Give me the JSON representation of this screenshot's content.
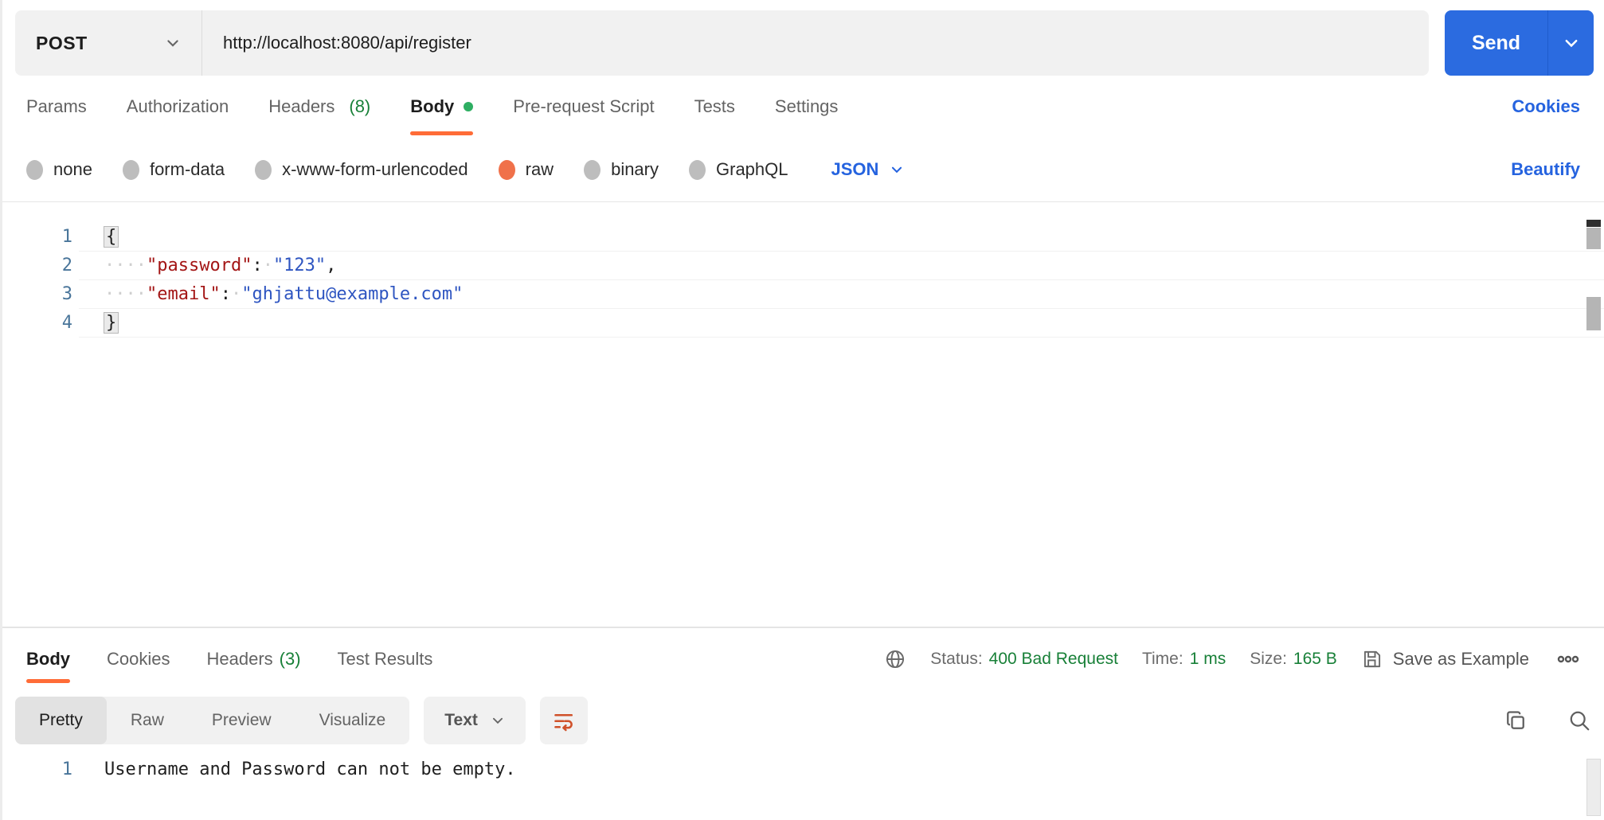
{
  "accents": {
    "orange": "#ff6c37",
    "blue": "#2563df",
    "send_blue": "#2b6be0",
    "green": "#188038",
    "unsaved_dot_green": "#2eae62",
    "key_red": "#a31515",
    "value_blue": "#2e55c1",
    "line_number_blue": "#49759a"
  },
  "request": {
    "method": "POST",
    "url": "http://localhost:8080/api/register",
    "send_label": "Send",
    "cookies_link": "Cookies",
    "beautify_link": "Beautify",
    "tabs": [
      {
        "label": "Params"
      },
      {
        "label": "Authorization"
      },
      {
        "label": "Headers",
        "count": "(8)"
      },
      {
        "label": "Body",
        "active": true,
        "dot": true
      },
      {
        "label": "Pre-request Script"
      },
      {
        "label": "Tests"
      },
      {
        "label": "Settings"
      }
    ],
    "body_modes": [
      {
        "label": "none"
      },
      {
        "label": "form-data"
      },
      {
        "label": "x-www-form-urlencoded"
      },
      {
        "label": "raw",
        "selected": true
      },
      {
        "label": "binary"
      },
      {
        "label": "GraphQL"
      }
    ],
    "language": "JSON",
    "editor_lines": [
      {
        "n": "1",
        "tokens": [
          [
            "brk",
            "{"
          ]
        ]
      },
      {
        "n": "2",
        "tokens": [
          [
            "ws",
            "····"
          ],
          [
            "key",
            "\"password\""
          ],
          [
            "pun",
            ":"
          ],
          [
            "ws",
            "·"
          ],
          [
            "val",
            "\"123\""
          ],
          [
            "pun",
            ","
          ]
        ]
      },
      {
        "n": "3",
        "tokens": [
          [
            "ws",
            "····"
          ],
          [
            "key",
            "\"email\""
          ],
          [
            "pun",
            ":"
          ],
          [
            "ws",
            "·"
          ],
          [
            "val",
            "\"ghjattu@example.com\""
          ]
        ]
      },
      {
        "n": "4",
        "tokens": [
          [
            "brk",
            "}"
          ]
        ]
      }
    ]
  },
  "response": {
    "tabs": [
      {
        "label": "Body",
        "active": true
      },
      {
        "label": "Cookies"
      },
      {
        "label": "Headers",
        "count": "(3)"
      },
      {
        "label": "Test Results"
      }
    ],
    "status_label": "Status:",
    "status_value": "400 Bad Request",
    "time_label": "Time:",
    "time_value": "1 ms",
    "size_label": "Size:",
    "size_value": "165 B",
    "save_label": "Save as Example",
    "view_tabs": [
      {
        "label": "Pretty",
        "selected": true
      },
      {
        "label": "Raw"
      },
      {
        "label": "Preview"
      },
      {
        "label": "Visualize"
      }
    ],
    "format": "Text",
    "body_lines": [
      {
        "n": "1",
        "text": "Username and Password can not be empty."
      }
    ]
  }
}
